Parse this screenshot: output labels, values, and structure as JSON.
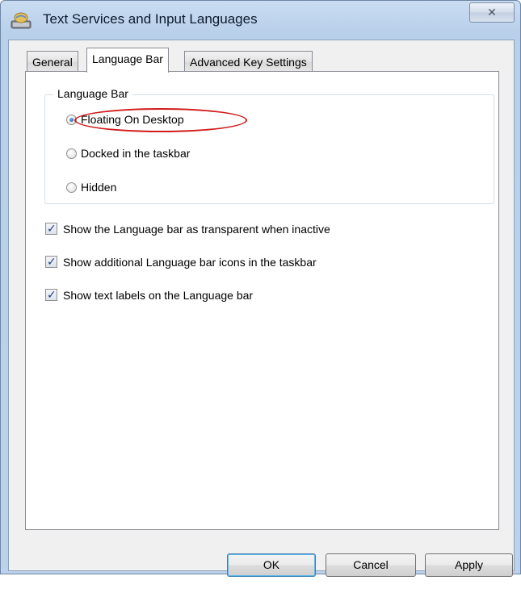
{
  "window": {
    "title": "Text Services and Input Languages",
    "close_glyph": "✕"
  },
  "tabs": [
    {
      "label": "General",
      "active": false
    },
    {
      "label": "Language Bar",
      "active": true
    },
    {
      "label": "Advanced Key Settings",
      "active": false
    }
  ],
  "language_bar_group": {
    "legend": "Language Bar",
    "options": [
      {
        "label": "Floating On Desktop",
        "selected": true
      },
      {
        "label": "Docked in the taskbar",
        "selected": false
      },
      {
        "label": "Hidden",
        "selected": false
      }
    ]
  },
  "checkboxes": [
    {
      "label": "Show the Language bar as transparent when inactive",
      "checked": true
    },
    {
      "label": "Show additional Language bar icons in the taskbar",
      "checked": true
    },
    {
      "label": "Show text labels on the Language bar",
      "checked": true
    }
  ],
  "buttons": {
    "ok": "OK",
    "cancel": "Cancel",
    "apply": "Apply"
  },
  "colors": {
    "highlight_ellipse": "#d21a1a",
    "title_bar": "#c9dcf1",
    "radio_selected": "#0c4f9b"
  },
  "icons": {
    "window": "keyboard-globe-icon",
    "close": "close-icon"
  }
}
